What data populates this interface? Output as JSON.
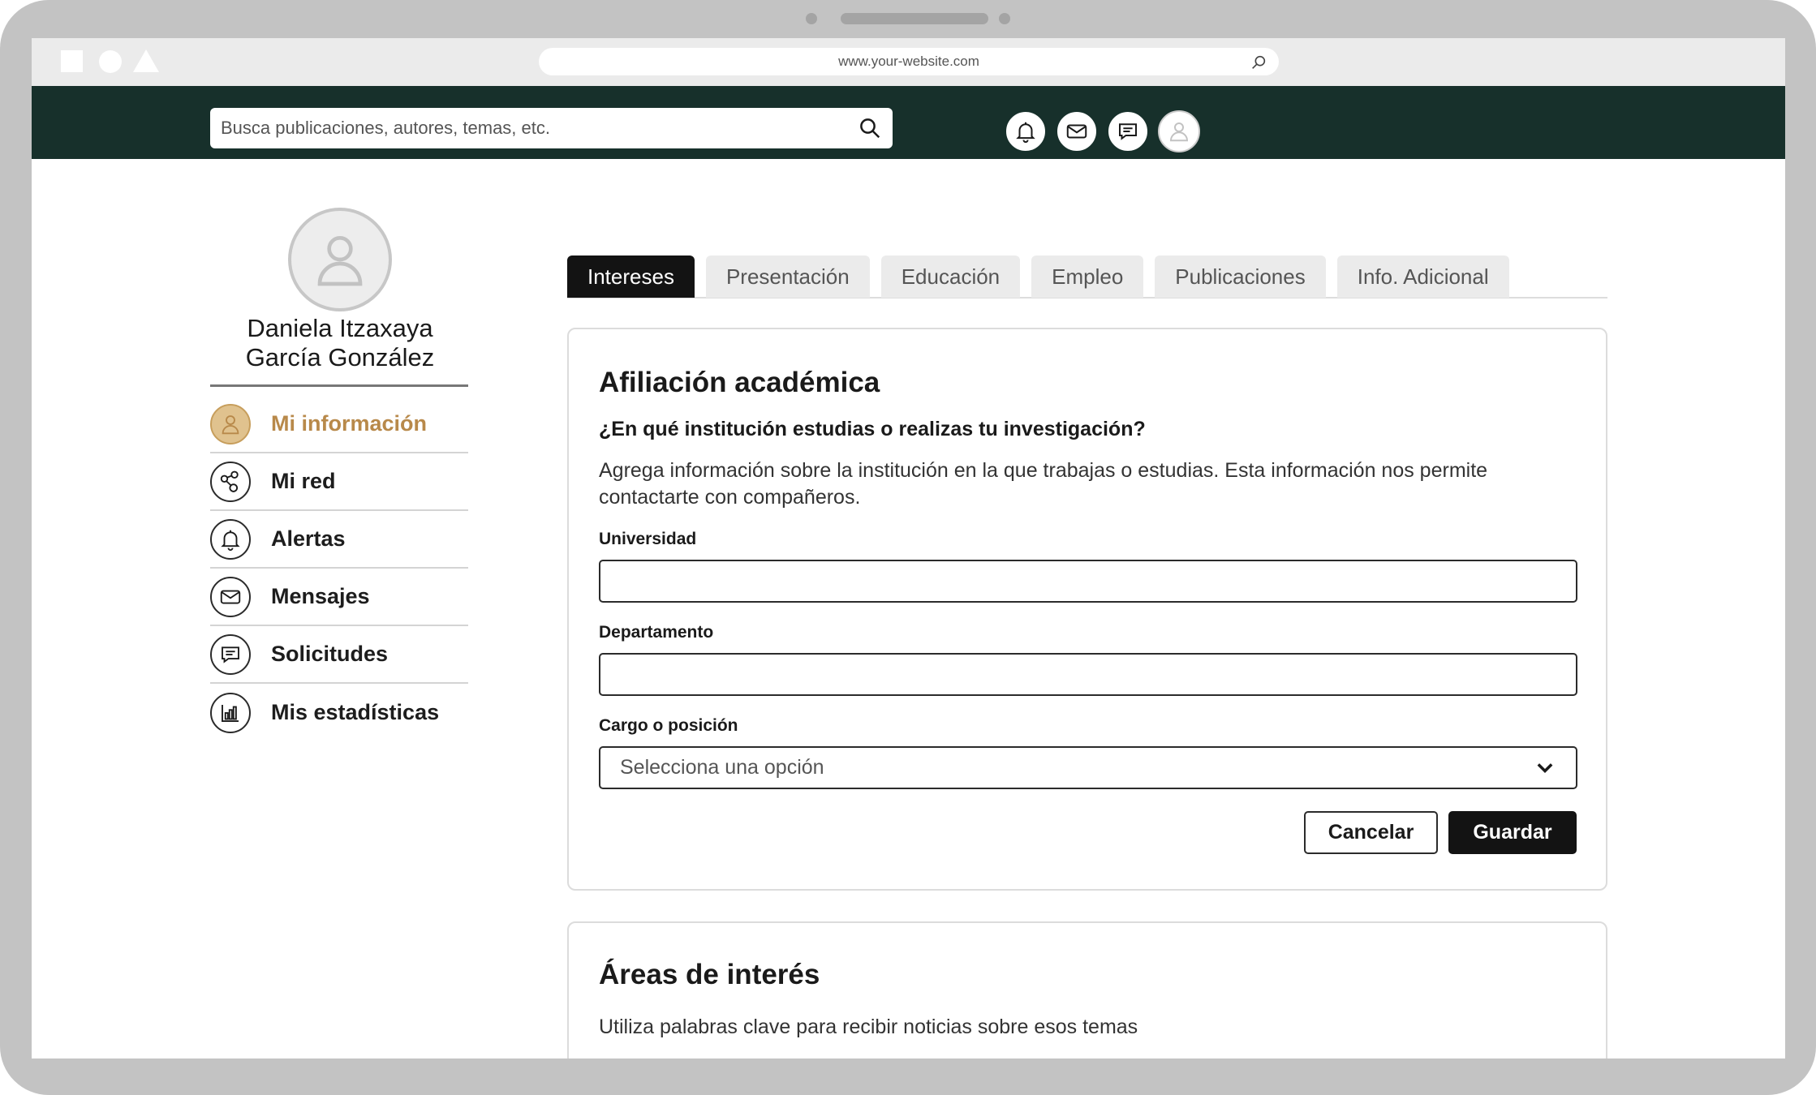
{
  "browser": {
    "url": "www.your-website.com"
  },
  "header": {
    "search_placeholder": "Busca publicaciones, autores, temas, etc.",
    "icons": [
      "bell-icon",
      "mail-icon",
      "chat-icon",
      "user-avatar-icon"
    ]
  },
  "profile": {
    "name_line1": "Daniela Itzaxaya",
    "name_line2": "García González"
  },
  "sidebar": {
    "items": [
      {
        "label": "Mi información",
        "icon": "user-icon",
        "active": true
      },
      {
        "label": "Mi red",
        "icon": "network-icon",
        "active": false
      },
      {
        "label": "Alertas",
        "icon": "bell-icon",
        "active": false
      },
      {
        "label": "Mensajes",
        "icon": "mail-icon",
        "active": false
      },
      {
        "label": "Solicitudes",
        "icon": "chat-icon",
        "active": false
      },
      {
        "label": "Mis estadísticas",
        "icon": "bar-chart-icon",
        "active": false
      }
    ]
  },
  "tabs": [
    {
      "label": "Intereses",
      "active": true
    },
    {
      "label": "Presentación",
      "active": false
    },
    {
      "label": "Educación",
      "active": false
    },
    {
      "label": "Empleo",
      "active": false
    },
    {
      "label": "Publicaciones",
      "active": false
    },
    {
      "label": "Info. Adicional",
      "active": false
    }
  ],
  "affiliation": {
    "title": "Afiliación académica",
    "question": "¿En qué institución estudias o realizas tu investigación?",
    "description": "Agrega información sobre la institución en la que trabajas o estudias. Esta información nos permite contactarte con compañeros.",
    "university_label": "Universidad",
    "university_value": "",
    "department_label": "Departamento",
    "department_value": "",
    "position_label": "Cargo o posición",
    "position_value": "Selecciona una opción",
    "cancel_label": "Cancelar",
    "save_label": "Guardar"
  },
  "interests": {
    "title": "Áreas de interés",
    "description": "Utiliza palabras clave para recibir noticias sobre esos temas"
  },
  "colors": {
    "header_bg": "#17302b",
    "accent_gold": "#b8894a",
    "active_tab": "#131313"
  }
}
